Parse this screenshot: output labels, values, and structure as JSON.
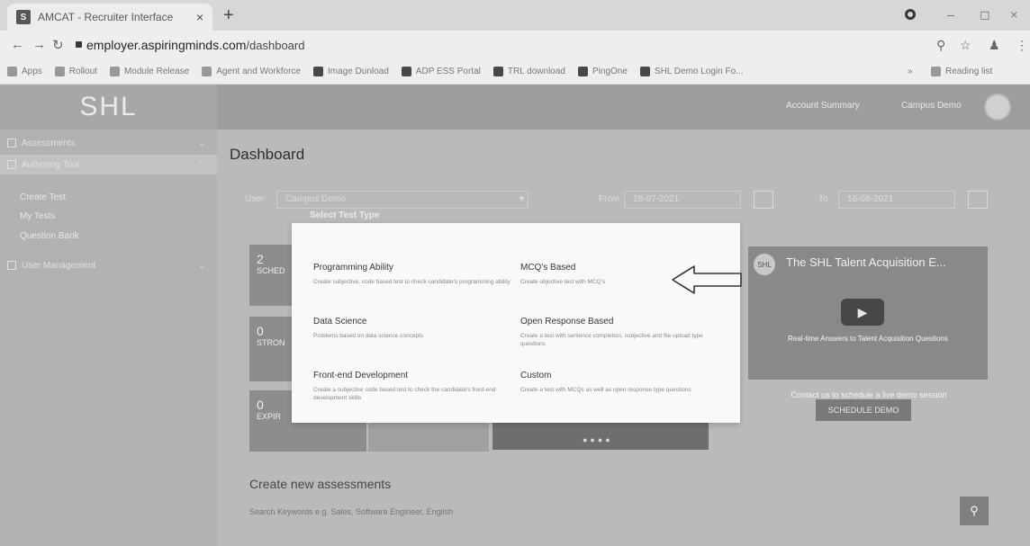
{
  "browser": {
    "tab_title": "AMCAT - Recruiter Interface",
    "tab_icon_letter": "S",
    "url_host": "employer.aspiringminds.com",
    "url_path": "/dashboard",
    "bookmarks": [
      {
        "label": "Apps"
      },
      {
        "label": "Rollout"
      },
      {
        "label": "Module Release"
      },
      {
        "label": "Agent and Workforce"
      },
      {
        "label": "Image Dunload"
      },
      {
        "label": "ADP ESS Portal"
      },
      {
        "label": "TRL download"
      },
      {
        "label": "PingOne"
      },
      {
        "label": "SHL Demo Login Fo..."
      }
    ],
    "more_bookmarks": "»",
    "reading_list": "Reading list"
  },
  "app": {
    "logo": "SHL",
    "sidebar": {
      "items": [
        {
          "label": "Assessments"
        },
        {
          "label": "Authoring Tool"
        }
      ],
      "sub_items": [
        {
          "label": "Create Test"
        },
        {
          "label": "My Tests"
        },
        {
          "label": "Question Bank"
        }
      ],
      "user_management": "User Management"
    },
    "topnav": {
      "account_summary": "Account Summary",
      "campus_demo": "Campus Demo"
    },
    "dashboard": {
      "title": "Dashboard",
      "user_label": "User",
      "user_value": "Campus Demo",
      "from_label": "From",
      "from_value": "16-07-2021",
      "to_label": "To",
      "to_value": "16-08-2021"
    },
    "cards": [
      {
        "count": "2",
        "label": "SCHED"
      },
      {
        "count": "0",
        "label": "STRON"
      },
      {
        "count": "0",
        "label": "EXPIR"
      }
    ],
    "video": {
      "logo": "SHL",
      "title": "The SHL Talent Acquisition E...",
      "caption": "Real-time Answers to Talent Acquisition Questions"
    },
    "contact_text": "Contact us to schedule a live demo session",
    "schedule_demo": "SCHEDULE DEMO",
    "create_new_title": "Create new assessments",
    "search_placeholder": "Search Keywords e.g. Sales, Software Engineer, English"
  },
  "modal": {
    "title": "Select Test Type",
    "options": [
      {
        "title": "Programming Ability",
        "desc": "Create subjective, code based test to check candidate's programming ability"
      },
      {
        "title": "MCQ's Based",
        "desc": "Create objective test with MCQ's"
      },
      {
        "title": "Data Science",
        "desc": "Problems based on data science concepts"
      },
      {
        "title": "Open Response Based",
        "desc": "Create a test with sentence completion, subjective and file upload type questions"
      },
      {
        "title": "Front-end Development",
        "desc": "Create a subjective code based test to check the candidate's front-end development skills"
      },
      {
        "title": "Custom",
        "desc": "Create a test with MCQs as well as open response type questions"
      }
    ]
  },
  "icons": {
    "back": "arrow-left-icon",
    "forward": "arrow-right-icon",
    "reload": "reload-icon",
    "annotation_arrow": "hand-drawn-arrow-icon"
  }
}
